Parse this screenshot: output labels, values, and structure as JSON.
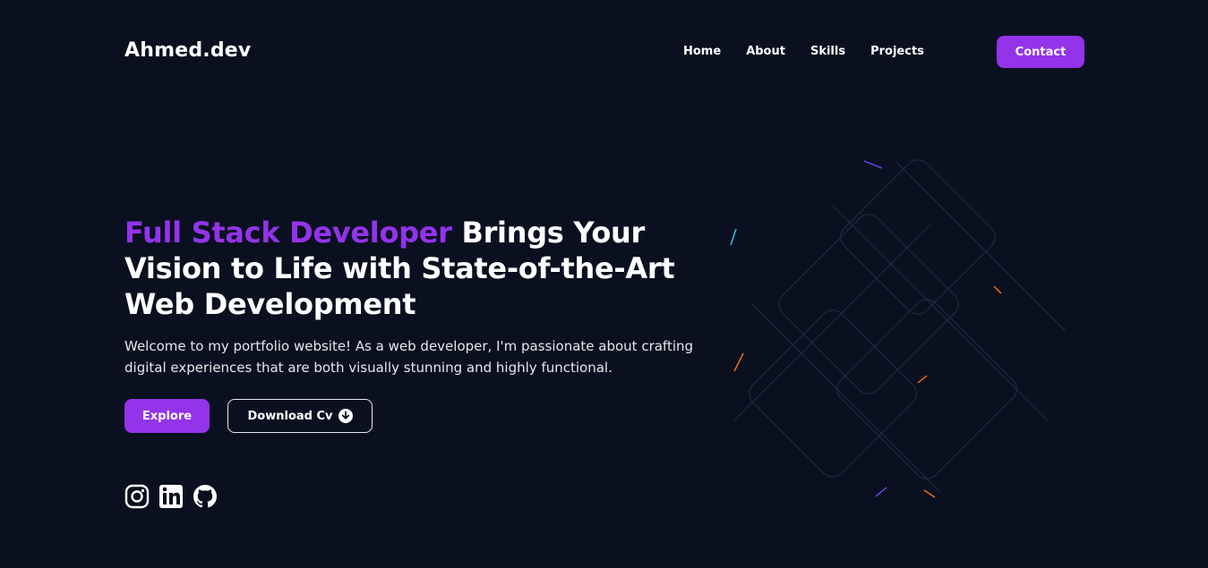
{
  "brand": {
    "logo": "Ahmed.dev"
  },
  "nav": {
    "items": [
      "Home",
      "About",
      "Skills",
      "Projects"
    ],
    "contact_label": "Contact"
  },
  "hero": {
    "title_accent": "Full Stack Developer",
    "title_rest": " Brings Your Vision to Life with State-of-the-Art Web Development",
    "description": "Welcome to my portfolio website! As a web developer, I'm passionate about crafting digital experiences that are both visually stunning and highly functional.",
    "explore_label": "Explore",
    "cv_label": "Download Cv"
  },
  "socials": [
    "instagram-icon",
    "linkedin-icon",
    "github-icon"
  ],
  "colors": {
    "background": "#0b1020",
    "accent": "#9333ea",
    "text": "#ffffff"
  }
}
